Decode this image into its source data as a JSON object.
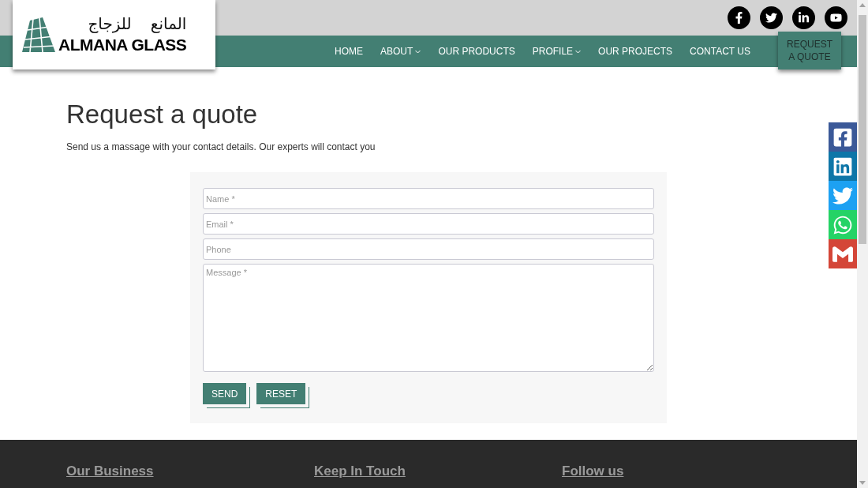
{
  "logo": {
    "arabic": "المانع للزجاج",
    "name": "ALMANA GLASS"
  },
  "top_social": [
    {
      "kind": "facebook"
    },
    {
      "kind": "twitter"
    },
    {
      "kind": "linkedin"
    },
    {
      "kind": "youtube"
    }
  ],
  "nav": [
    {
      "label": "HOME",
      "dropdown": false
    },
    {
      "label": "ABOUT",
      "dropdown": true
    },
    {
      "label": "OUR PRODUCTS",
      "dropdown": false
    },
    {
      "label": "PROFILE",
      "dropdown": true
    },
    {
      "label": "OUR PROJECTS",
      "dropdown": false
    },
    {
      "label": "CONTACT US",
      "dropdown": false
    }
  ],
  "quote_button": "REQUEST A QUOTE",
  "heading": "Request a quote",
  "subtitle": "Send us a massage with your contact details. Our experts will contact you",
  "form": {
    "fields": [
      {
        "kind": "input",
        "placeholder": "Name *"
      },
      {
        "kind": "input",
        "placeholder": "Email *"
      },
      {
        "kind": "input",
        "placeholder": "Phone"
      },
      {
        "kind": "textarea",
        "placeholder": "Message *"
      }
    ],
    "buttons": [
      "SEND",
      "RESET"
    ]
  },
  "share_bar": [
    {
      "kind": "facebook",
      "color": "#3b5998"
    },
    {
      "kind": "linkedin",
      "color": "#0e76a8"
    },
    {
      "kind": "twitter",
      "color": "#1da1f2"
    },
    {
      "kind": "whatsapp",
      "color": "#25d366"
    },
    {
      "kind": "gmail",
      "color": "#d44638"
    }
  ],
  "footer": {
    "headings": [
      "Our Business",
      "Keep In Touch",
      "Follow us"
    ]
  }
}
